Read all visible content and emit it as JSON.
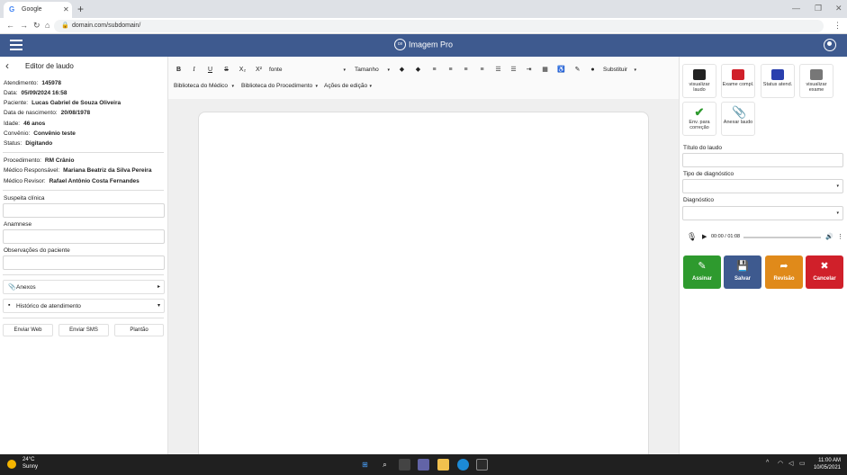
{
  "browser": {
    "tab_title": "Google",
    "url": "domain.com/subdomain/"
  },
  "app": {
    "name": "Imagem Pro",
    "logo_mark": "ce"
  },
  "left": {
    "title": "Editor de laudo",
    "info": [
      {
        "label": "Atendimento:",
        "value": "145978"
      },
      {
        "label": "Data:",
        "value": "05/09/2024 16:58"
      },
      {
        "label": "Paciente:",
        "value": "Lucas Gabriel de Souza Oliveira"
      },
      {
        "label": "Data de nascimento:",
        "value": "20/08/1978"
      },
      {
        "label": "Idade:",
        "value": "46 anos"
      },
      {
        "label": "Convênio:",
        "value": "Convênio teste"
      },
      {
        "label": "Status:",
        "value": "Digitando"
      }
    ],
    "doctors": [
      {
        "label": "Procedimento:",
        "value": "RM Crânio"
      },
      {
        "label": "Médico Responsável:",
        "value": "Mariana Beatriz da Silva Pereira"
      },
      {
        "label": "Médico Revisor:",
        "value": "Rafael Antônio Costa Fernandes"
      }
    ],
    "fields": {
      "suspeita": "Suspeita clínica",
      "anamnese": "Anamnese",
      "observacoes": "Observações do paciente"
    },
    "accordions": {
      "anexos": "Anexos",
      "historico": "Histórico de atendimento"
    },
    "buttons": {
      "web": "Enviar Web",
      "sms": "Enviar SMS",
      "plantao": "Plantão"
    }
  },
  "toolbar": {
    "font": "fonte",
    "size": "Tamanho",
    "replace": "Substituir",
    "lib_medico": "Biblioteca do Médico",
    "lib_proc": "Biblioteca do Procedimento",
    "actions": "Ações de edição"
  },
  "right": {
    "quick": [
      {
        "label": "visualizar laudo"
      },
      {
        "label": "Exame compl."
      },
      {
        "label": "Status atend."
      },
      {
        "label": "visualizar exame"
      },
      {
        "label": "Env. para correção"
      },
      {
        "label": "Anexar laudo"
      }
    ],
    "titulo_label": "Título do laudo",
    "tipo_label": "Tipo de diagnóstico",
    "diag_label": "Diagnóstico",
    "audio_time": "00:00 / 01:08",
    "actions": {
      "assinar": "Assinar",
      "salvar": "Salvar",
      "revisao": "Revisão",
      "cancelar": "Cancelar"
    },
    "colors": {
      "assinar": "#2e9a2e",
      "salvar": "#3e5a8f",
      "revisao": "#e08a1a",
      "cancelar": "#d0202a"
    }
  },
  "taskbar": {
    "temp": "24°C",
    "cond": "Sunny",
    "time": "11:00 AM",
    "date": "10/05/2021"
  }
}
